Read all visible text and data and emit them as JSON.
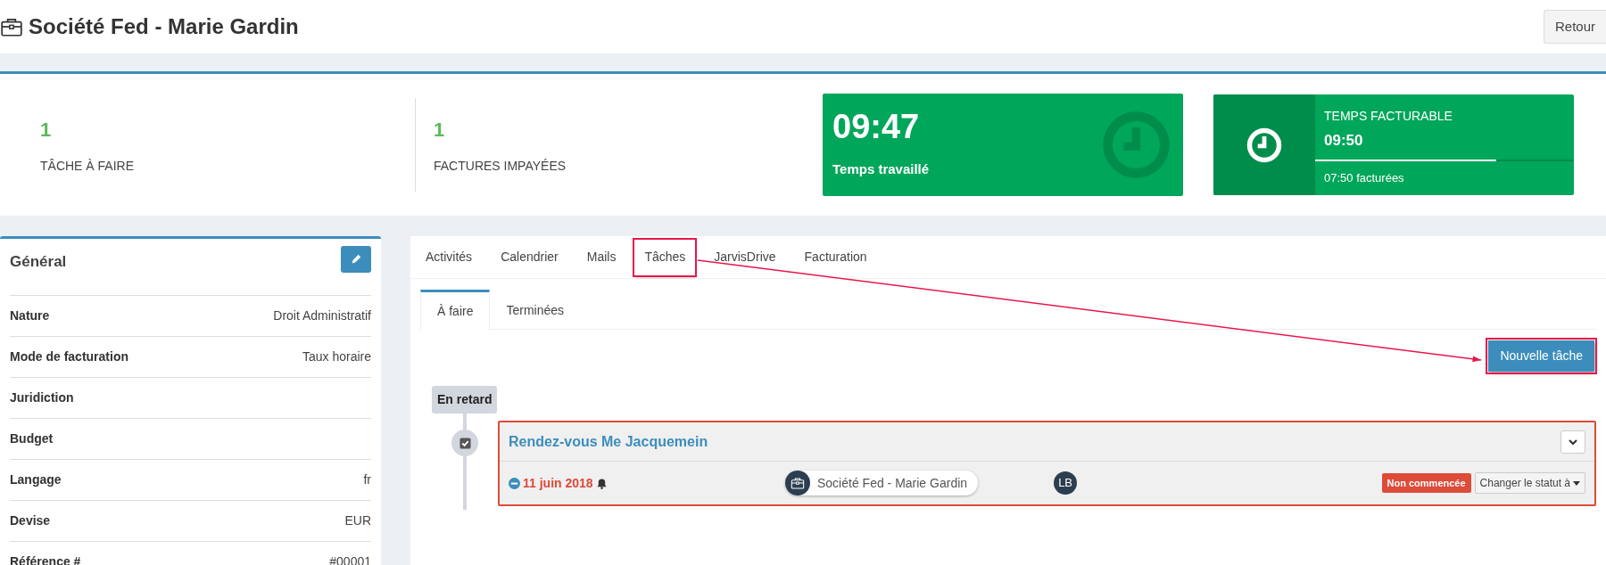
{
  "header": {
    "title": "Société Fed - Marie Gardin",
    "back_button": "Retour"
  },
  "stats": [
    {
      "value": "1",
      "label": "TÂCHE À FAIRE"
    },
    {
      "value": "1",
      "label": "FACTURES IMPAYÉES"
    }
  ],
  "worked_time": {
    "value": "09:47",
    "label": "Temps travaillé"
  },
  "billable_time": {
    "title": "TEMPS FACTURABLE",
    "value": "09:50",
    "level": 0.7,
    "footer": "07:50 facturées"
  },
  "general": {
    "title": "Général",
    "fields": [
      {
        "label": "Nature",
        "value": "Droit Administratif"
      },
      {
        "label": "Mode de facturation",
        "value": "Taux horaire"
      },
      {
        "label": "Juridiction"
      },
      {
        "label": "Budget"
      },
      {
        "label": "Langage",
        "value": "fr"
      },
      {
        "label": "Devise",
        "value": "EUR"
      },
      {
        "label": "Référence #",
        "value": "#00001"
      }
    ]
  },
  "tabs": [
    {
      "label": "Activités",
      "highlighted": false
    },
    {
      "label": "Calendrier",
      "highlighted": false
    },
    {
      "label": "Mails",
      "highlighted": false
    },
    {
      "label": "Tâches",
      "highlighted": true
    },
    {
      "label": "JarvisDrive",
      "highlighted": false
    },
    {
      "label": "Facturation",
      "highlighted": false
    }
  ],
  "subtabs": [
    {
      "label": "À faire",
      "selected": true
    },
    {
      "label": "Terminées",
      "selected": false
    }
  ],
  "new_task_button": {
    "label": "Nouvelle tâche",
    "highlighted": true
  },
  "timeline": {
    "group": "En retard",
    "tasks": [
      {
        "title": "Rendez-vous Me Jacquemein",
        "overdue": true,
        "date": "11 juin 2018",
        "reminder": true,
        "client": "Société Fed - Marie Gardin",
        "assignee": "LB",
        "status": "Non commencée",
        "status_menu": "Changer le statut à"
      }
    ]
  }
}
